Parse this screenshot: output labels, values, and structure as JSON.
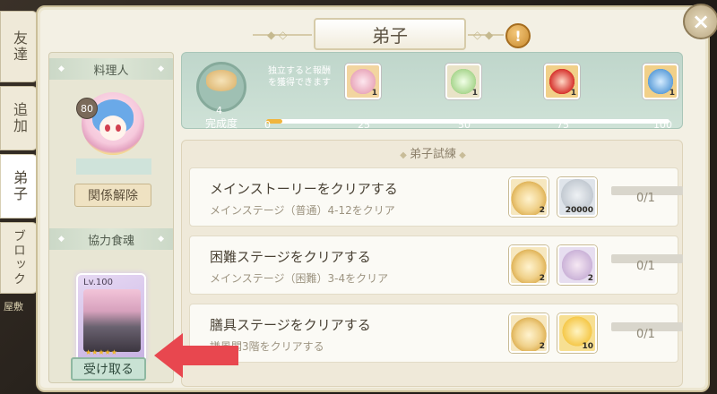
{
  "side_tabs": [
    "友達",
    "追加",
    "弟子",
    "ブロック"
  ],
  "side_tab_extra": "屋敷",
  "title": "弟子",
  "left_panel": {
    "cook_header": "料理人",
    "chef_level": "80",
    "unbind_button": "関係解除",
    "food_soul_header": "協力食魂",
    "card_level": "Lv.100",
    "card_stars": "★★★★★",
    "receive_button": "受け取る"
  },
  "progress": {
    "value": "4",
    "label": "完成度",
    "hint": "独立すると報酬を獲得できます",
    "current": 4,
    "max": 100,
    "ticks": [
      "0",
      "25",
      "50",
      "75",
      "100"
    ],
    "milestones": [
      {
        "icon": "dumplings-icon",
        "qty": "1"
      },
      {
        "icon": "green-gift-box-icon",
        "qty": "1"
      },
      {
        "icon": "red-gift-box-icon",
        "qty": "1"
      },
      {
        "icon": "mystery-box-icon",
        "qty": "1"
      }
    ]
  },
  "trials": {
    "header": "弟子試練",
    "tasks": [
      {
        "title": "メインストーリーをクリアする",
        "desc": "メインステージ（普通）4-12をクリア",
        "rewards": [
          {
            "icon": "soup-bowl-icon",
            "qty": "2"
          },
          {
            "icon": "silver-coin-icon",
            "qty": "20000"
          }
        ],
        "progress": "0/1"
      },
      {
        "title": "困難ステージをクリアする",
        "desc": "メインステージ（困難）3-4をクリア",
        "rewards": [
          {
            "icon": "soup-bowl-icon",
            "qty": "2"
          },
          {
            "icon": "sweets-icon",
            "qty": "2"
          }
        ],
        "progress": "0/1"
      },
      {
        "title": "膳具ステージをクリアする",
        "desc": "謙風閣3階をクリアする",
        "rewards": [
          {
            "icon": "soup-bowl-icon",
            "qty": "2"
          },
          {
            "icon": "gold-crystal-icon",
            "qty": "10"
          }
        ],
        "progress": "0/1"
      }
    ]
  },
  "colors": {
    "accent": "#f0b53e",
    "arrow": "#e8474f",
    "tab_bg": "#efe9d8"
  }
}
